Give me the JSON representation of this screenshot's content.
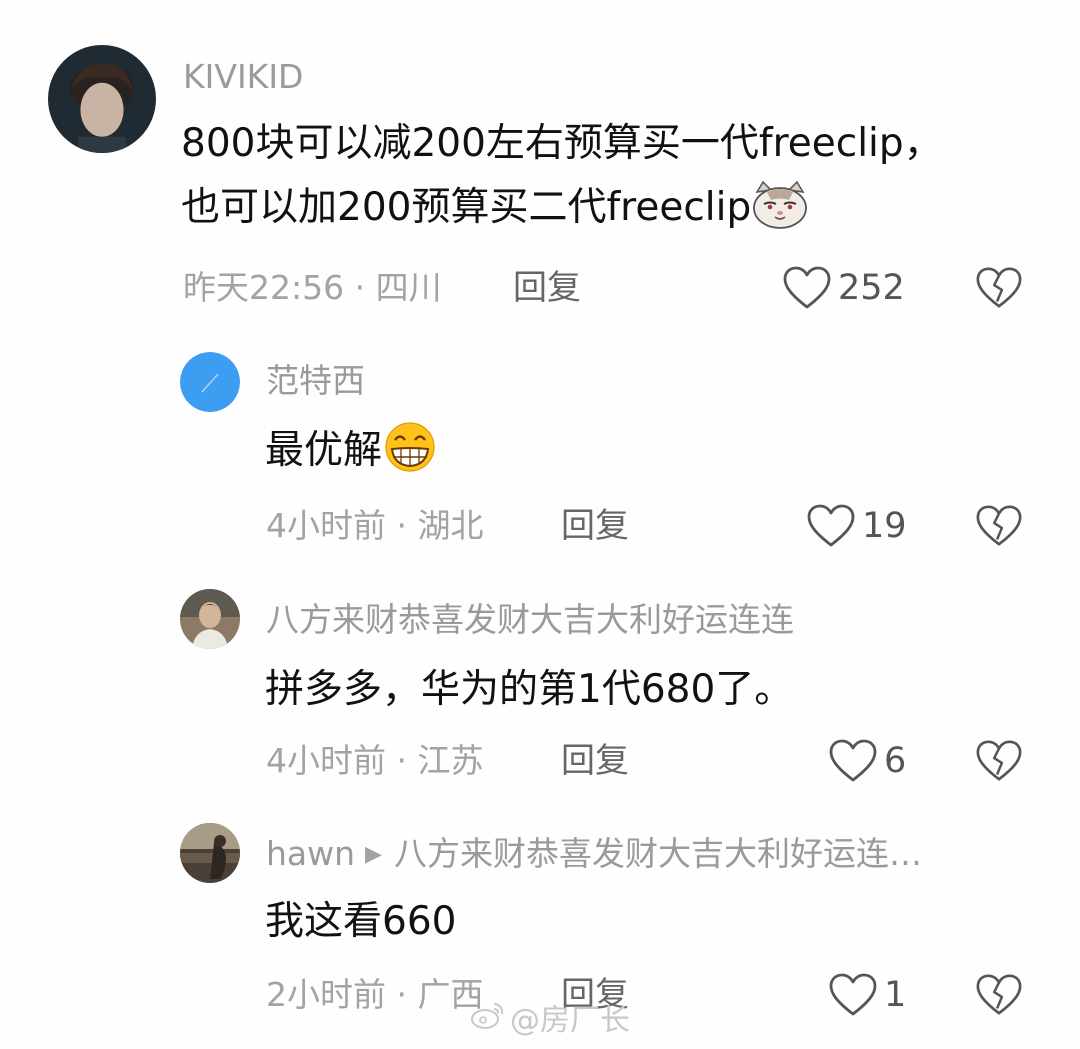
{
  "comments": [
    {
      "username": "KIVIKID",
      "avatar_icon": "user-avatar-photo",
      "content_lines": [
        "800块可以减200左右预算买一代freeclip，",
        "也可以加200预算买二代freeclip"
      ],
      "content_emoji": "cat-face-emoji",
      "time_location": "昨天22:56 · 四川",
      "reply_label": "回复",
      "likes": "252"
    },
    {
      "username": "范特西",
      "avatar_icon": "blue-circle-avatar",
      "content": "最优解",
      "content_emoji": "grinning-emoji",
      "time_location": "4小时前 · 湖北",
      "reply_label": "回复",
      "likes": "19"
    },
    {
      "username": "八方来财恭喜发财大吉大利好运连连",
      "avatar_icon": "user-avatar-photo",
      "content": "拼多多，华为的第1代680了。",
      "time_location": "4小时前 · 江苏",
      "reply_label": "回复",
      "likes": "6"
    },
    {
      "username": "hawn",
      "reply_to": "八方来财恭喜发财大吉大利好运连…",
      "avatar_icon": "user-avatar-photo",
      "content": "我这看660",
      "time_location": "2小时前 · 广西",
      "reply_label": "回复",
      "likes": "1"
    }
  ],
  "watermark": {
    "text": "@房厂长",
    "icon": "weibo-logo-icon"
  },
  "colors": {
    "username": "#9a9a9a",
    "content": "#111111",
    "meta": "#a3a3a3",
    "avatar_blue": "#3d9df0"
  }
}
